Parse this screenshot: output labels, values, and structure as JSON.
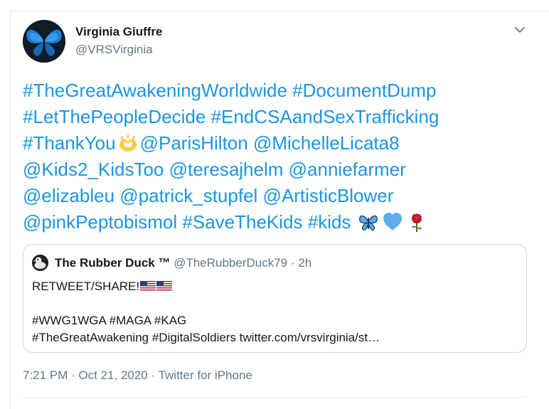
{
  "tweet": {
    "author_name": "Virginia Giuffre",
    "author_handle": "@VRSVirginia",
    "lines": [
      [
        "#TheGreatAwakeningWorldwide",
        " ",
        "#DocumentDump"
      ],
      [
        "#LetThePeopleDecide",
        " ",
        "#EndCSAandSexTrafficking"
      ],
      [
        "#ThankYou",
        "",
        "@ParisHilton",
        " ",
        "@MichelleLicata8"
      ],
      [
        "@Kids2_KidsToo",
        " ",
        "@teresajhelm",
        " ",
        "@anniefarmer"
      ],
      [
        "@elizableu",
        " ",
        "@patrick_stupfel",
        " ",
        "@ArtisticBlower"
      ],
      [
        "@pinkPeptobismol",
        " ",
        "#SaveTheKids",
        " ",
        "#kids"
      ]
    ],
    "emojis": [
      "heart-hands-emoji",
      "butterfly-emoji",
      "blue-heart-emoji",
      "rose-emoji"
    ],
    "link_color": "#1b95e0"
  },
  "quote": {
    "name": "The Rubber Duck ™",
    "handle_time": " @TheRubberDuck79 · 2h",
    "line1": "RETWEET/SHARE!",
    "line2": "#WWG1WGA #MAGA #KAG",
    "line3": "#TheGreatAwakening #DigitalSoldiers twitter.com/vrsvirginia/st…",
    "flag_icon": "us-flag-icon"
  },
  "meta": {
    "time": "7:21 PM",
    "separator1": " · ",
    "date": "Oct 21, 2020",
    "separator2": " · ",
    "source": "Twitter for iPhone"
  }
}
